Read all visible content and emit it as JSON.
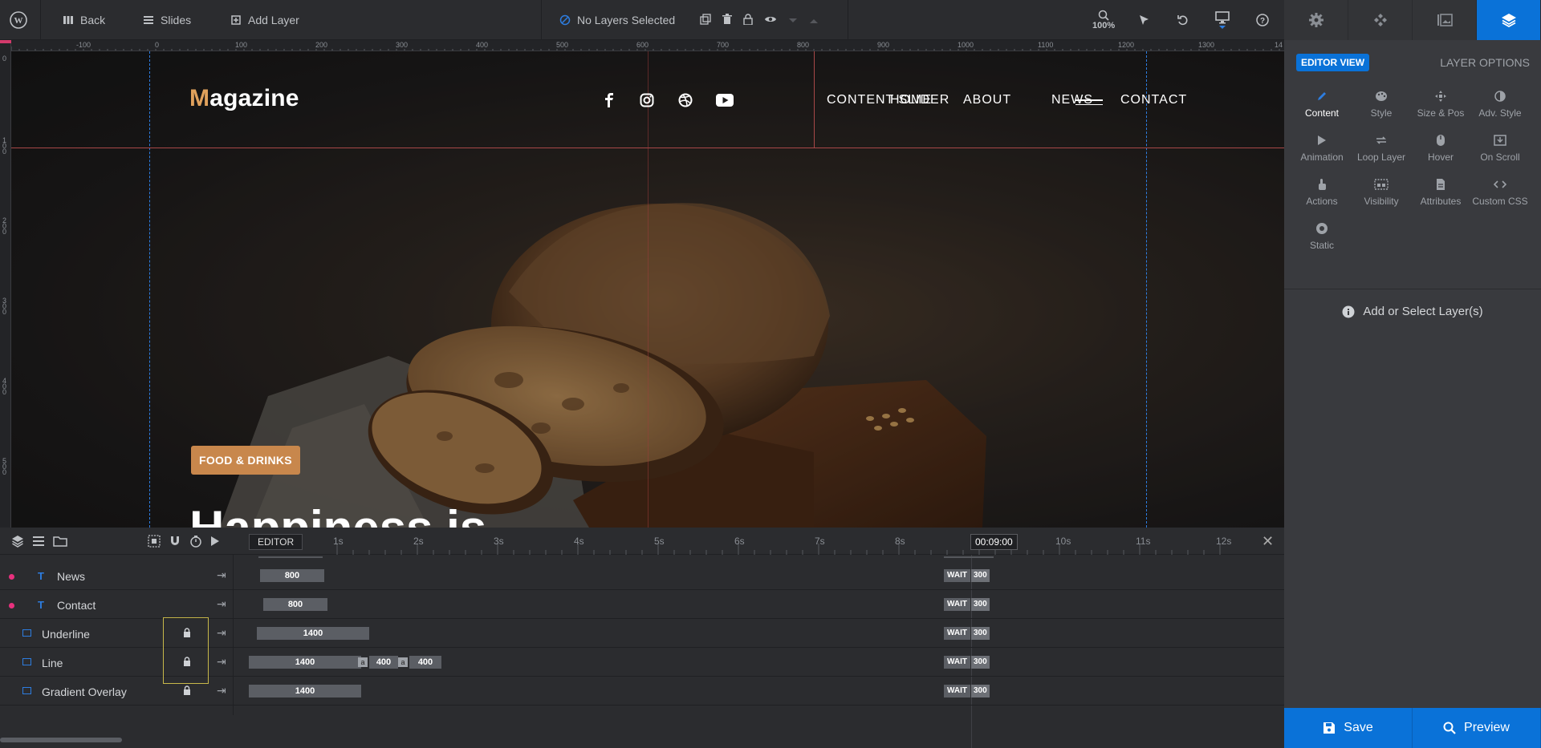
{
  "topbar": {
    "back": "Back",
    "slides": "Slides",
    "add_layer": "Add Layer",
    "layers_status": "No Layers Selected",
    "zoom": "100%"
  },
  "right_panel": {
    "editor_view": "EDITOR VIEW",
    "layer_options": "LAYER OPTIONS",
    "options": [
      {
        "label": "Content",
        "icon": "pencil-icon"
      },
      {
        "label": "Style",
        "icon": "palette-icon"
      },
      {
        "label": "Size & Pos",
        "icon": "move-icon"
      },
      {
        "label": "Adv. Style",
        "icon": "contrast-icon"
      },
      {
        "label": "Animation",
        "icon": "play-icon"
      },
      {
        "label": "Loop Layer",
        "icon": "loop-icon"
      },
      {
        "label": "Hover",
        "icon": "mouse-icon"
      },
      {
        "label": "On Scroll",
        "icon": "download-icon"
      },
      {
        "label": "Actions",
        "icon": "hand-icon"
      },
      {
        "label": "Visibility",
        "icon": "visibility-icon"
      },
      {
        "label": "Attributes",
        "icon": "file-icon"
      },
      {
        "label": "Custom CSS",
        "icon": "code-icon"
      },
      {
        "label": "Static",
        "icon": "target-icon"
      }
    ],
    "add_select": "Add or Select Layer(s)"
  },
  "buttons": {
    "save": "Save",
    "preview": "Preview"
  },
  "rulers": {
    "top": [
      "-100",
      "0",
      "100",
      "200",
      "300",
      "400",
      "500",
      "600",
      "700",
      "800",
      "900",
      "1000",
      "1100",
      "1200",
      "1300",
      "14"
    ],
    "left": [
      "0",
      "1\n0\n0",
      "2\n0\n0",
      "3\n0\n0",
      "4\n0\n0",
      "5\n0\n0"
    ]
  },
  "canvas": {
    "logo_first": "M",
    "logo_rest": "agazine",
    "nav": [
      "CONTENT SLIDER",
      "HOME",
      "ABOUT",
      "NEWS",
      "CONTACT"
    ],
    "tag": "FOOD & DRINKS",
    "headline": "Happiness is"
  },
  "timeline": {
    "editor": "EDITOR",
    "seconds": [
      "1s",
      "2s",
      "3s",
      "4s",
      "5s",
      "6s",
      "7s",
      "8s",
      "10s",
      "11s",
      "12s"
    ],
    "time": "00:09:00",
    "rows": [
      {
        "name": "News",
        "type": "text",
        "bars": [
          "800"
        ],
        "wait": "WAIT",
        "wait_val": "300"
      },
      {
        "name": "Contact",
        "type": "text",
        "bars": [
          "800"
        ],
        "wait": "WAIT",
        "wait_val": "300"
      },
      {
        "name": "Underline",
        "type": "shape",
        "bars": [
          "1400"
        ],
        "wait": "WAIT",
        "wait_val": "300"
      },
      {
        "name": "Line",
        "type": "shape",
        "bars": [
          "1400",
          "400",
          "400"
        ],
        "sub": "a",
        "wait": "WAIT",
        "wait_val": "300"
      },
      {
        "name": "Gradient Overlay",
        "type": "shape",
        "bars": [
          "1400"
        ],
        "wait": "WAIT",
        "wait_val": "300"
      }
    ]
  },
  "colors": {
    "accent": "#0a72d8",
    "brand": "#e0a15c",
    "tag": "#c8874c",
    "dot": "#e8317e"
  }
}
